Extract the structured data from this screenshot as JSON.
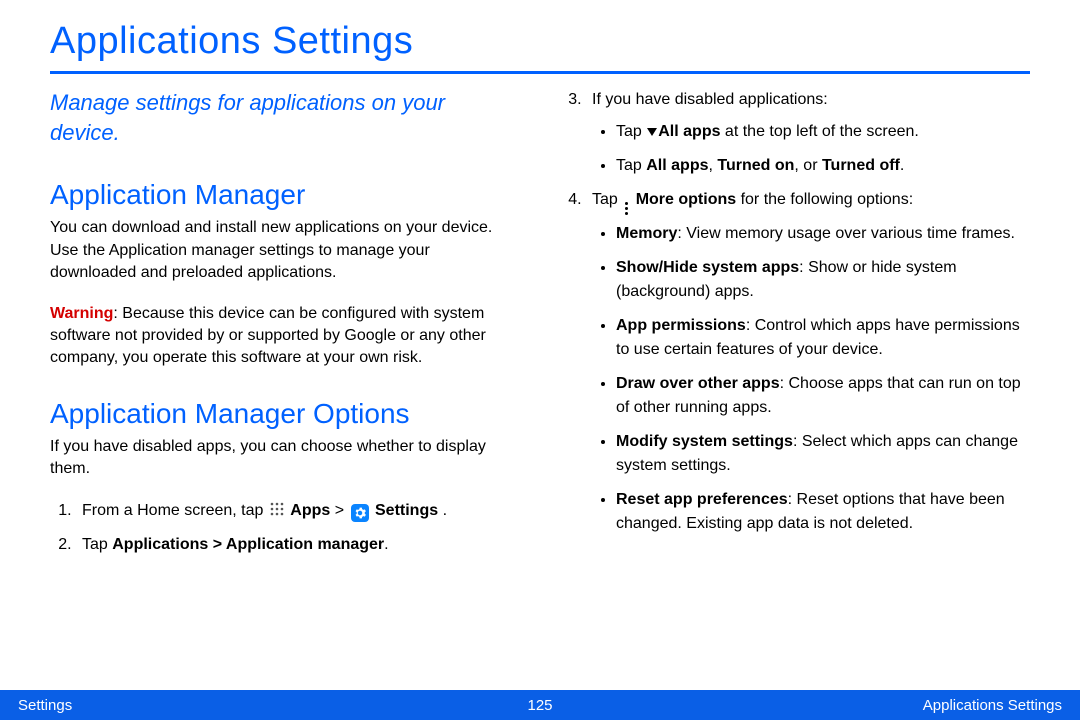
{
  "title": "Applications Settings",
  "subtitle": "Manage settings for applications on your device.",
  "section1": {
    "heading": "Application Manager",
    "para": "You can download and install new applications on your device. Use the Application manager settings to manage your downloaded and preloaded applications.",
    "warn_label": "Warning",
    "warn_text": ": Because this device can be configured with system software not provided by or supported by Google or any other company, you operate this software at your own risk."
  },
  "section2": {
    "heading": "Application Manager Options",
    "para": "If you have disabled apps, you can choose whether to display them.",
    "step1_pre": "From a Home screen, tap ",
    "step1_apps": "Apps",
    "step1_gt": " > ",
    "step1_settings": "Settings",
    "step1_post": " .",
    "step2_pre": "Tap ",
    "step2_path": "Applications > Application manager",
    "step2_post": "."
  },
  "right": {
    "step3_text": "If you have disabled applications:",
    "s3b1_pre": "Tap ",
    "s3b1_bold": "All apps",
    "s3b1_post": " at the top left of the screen.",
    "s3b2_pre": "Tap ",
    "s3b2_b1": "All apps",
    "s3b2_c1": ", ",
    "s3b2_b2": "Turned on",
    "s3b2_c2": ", or ",
    "s3b2_b3": "Turned off",
    "s3b2_post": ".",
    "step4_pre": "Tap ",
    "step4_bold": "More options",
    "step4_post": " for the following options:",
    "s4_memory_b": "Memory",
    "s4_memory_t": ": View memory usage over various time frames.",
    "s4_showhide_b": "Show/Hide system apps",
    "s4_showhide_t": ": Show or hide system (background) apps.",
    "s4_perm_b": "App permissions",
    "s4_perm_t": ": Control which apps have permissions to use certain features of your device.",
    "s4_draw_b": "Draw over other apps",
    "s4_draw_t": ": Choose apps that can run on top of other running apps.",
    "s4_mod_b": "Modify system settings",
    "s4_mod_t": ": Select which apps can change system settings.",
    "s4_reset_b": "Reset app preferences",
    "s4_reset_t": ": Reset options that have been changed. Existing app data is not deleted."
  },
  "footer": {
    "left": "Settings",
    "page": "125",
    "right": "Applications Settings"
  }
}
